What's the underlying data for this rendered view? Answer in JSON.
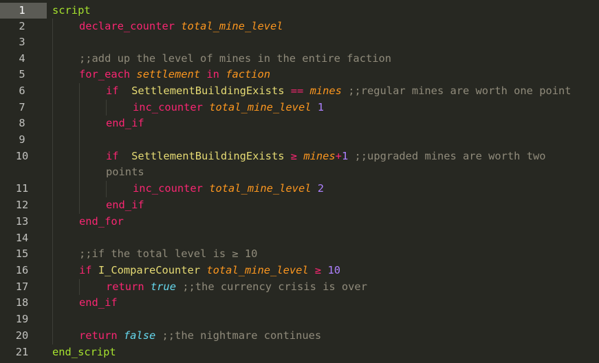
{
  "editor": {
    "active_line": 1,
    "line_numbers": [
      "1",
      "2",
      "3",
      "4",
      "5",
      "6",
      "7",
      "8",
      "9",
      "10",
      "11",
      "12",
      "13",
      "14",
      "15",
      "16",
      "17",
      "18",
      "19",
      "20",
      "21"
    ],
    "lines": {
      "l1": {
        "kw": "script"
      },
      "l2": {
        "kw": "declare_counter",
        "var": "total_mine_level"
      },
      "l4": {
        "comment": ";;add up the level of mines in the entire faction"
      },
      "l5": {
        "kw": "for_each",
        "var1": "settlement",
        "kw2": "in",
        "var2": "faction"
      },
      "l6": {
        "kw": "if",
        "fn": "SettlementBuildingExists",
        "op": "==",
        "var": "mines",
        "comment": ";;regular mines are worth one point"
      },
      "l7": {
        "kw": "inc_counter",
        "var": "total_mine_level",
        "num": "1"
      },
      "l8": {
        "kw": "end_if"
      },
      "l10": {
        "kw": "if",
        "fn": "SettlementBuildingExists",
        "op": "≥",
        "var": "mines",
        "plus": "+",
        "num": "1",
        "comment": ";;upgraded mines are worth two",
        "comment_wrap": "points"
      },
      "l11": {
        "kw": "inc_counter",
        "var": "total_mine_level",
        "num": "2"
      },
      "l12": {
        "kw": "end_if"
      },
      "l13": {
        "kw": "end_for"
      },
      "l15": {
        "comment": ";;if the total level is ≥ 10"
      },
      "l16": {
        "kw": "if",
        "fn": "I_CompareCounter",
        "var": "total_mine_level",
        "op": "≥",
        "num": "10"
      },
      "l17": {
        "kw": "return",
        "bool": "true",
        "comment": ";;the currency crisis is over"
      },
      "l18": {
        "kw": "end_if"
      },
      "l20": {
        "kw": "return",
        "bool": "false",
        "comment": ";;the nightmare continues"
      },
      "l21": {
        "kw": "end_script"
      }
    },
    "colors": {
      "background": "#272822",
      "keyword_green": "#a6e22e",
      "keyword_pink": "#f92672",
      "variable_orange": "#fd971f",
      "boolean_cyan": "#66d9ef",
      "function_yellow": "#e6db74",
      "number_purple": "#ae81ff",
      "comment_gray": "#908b7b"
    }
  }
}
